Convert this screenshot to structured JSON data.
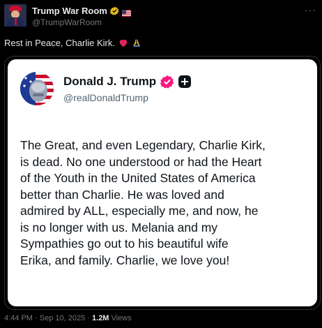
{
  "tweet": {
    "author": {
      "display_name": "Trump War Room",
      "handle": "@TrumpWarRoom"
    },
    "more_label": "···",
    "text": "Rest in Peace, Charlie Kirk.",
    "emojis": [
      "red-heart",
      "folded-hands"
    ],
    "embedded_post": {
      "author_name": "Donald J. Trump",
      "author_handle": "@realDonaldTrump",
      "body": "The Great, and even Legendary, Charlie Kirk,\nis dead. No one understood or had the Heart\nof the Youth in the United States of America\nbetter than Charlie. He was loved and\nadmired by ALL, especially me, and now, he\nis no longer with us. Melania and my\nSympathies go out to his beautiful wife\nErika, and family. Charlie, we love you!"
    },
    "meta": {
      "time": "4:44 PM",
      "separator": "·",
      "date": "Sep 10, 2025",
      "views_count": "1.2M",
      "views_label": "Views"
    }
  },
  "colors": {
    "background": "#000000",
    "text_primary": "#e7e9ea",
    "text_secondary": "#71767b",
    "verified_gold": "#e2b719",
    "verified_pink": "#f91880",
    "embed_background": "#ffffff"
  }
}
